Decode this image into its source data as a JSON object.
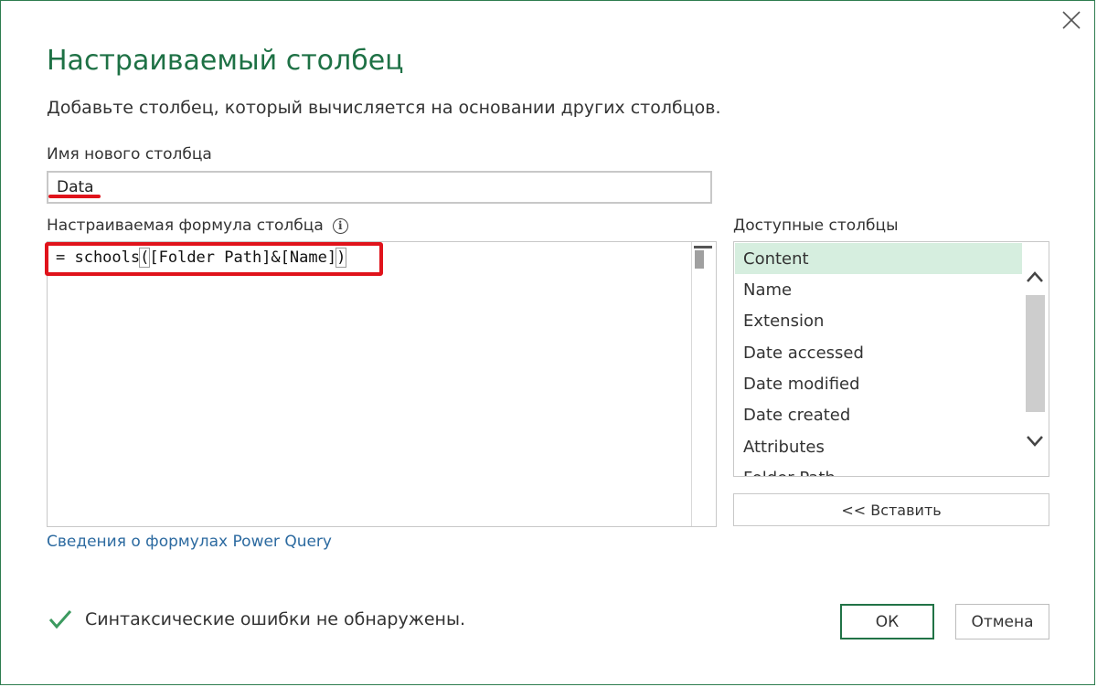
{
  "dialog": {
    "title": "Настраиваемый столбец",
    "subtitle": "Добавьте столбец, который вычисляется на основании других столбцов."
  },
  "column_name": {
    "label": "Имя нового столбца",
    "value": "Data"
  },
  "formula": {
    "label": "Настраиваемая формула столбца",
    "info_icon": "info-icon",
    "prefix": "= schools",
    "open_paren": "(",
    "args": "[Folder Path]&[Name]",
    "close_paren": ")"
  },
  "available_columns": {
    "label": "Доступные столбцы",
    "items": [
      "Content",
      "Name",
      "Extension",
      "Date accessed",
      "Date modified",
      "Date created",
      "Attributes",
      "Folder Path"
    ],
    "selected": "Content"
  },
  "insert_button": "<< Вставить",
  "docs_link": "Сведения о формулах Power Query",
  "status": {
    "icon": "checkmark-icon",
    "text": "Синтаксические ошибки не обнаружены."
  },
  "buttons": {
    "ok": "ОК",
    "cancel": "Отмена"
  },
  "colors": {
    "accent": "#1e7145",
    "highlight": "#e0131b",
    "selected_row": "#d6eedf",
    "link": "#2c6aa0"
  }
}
